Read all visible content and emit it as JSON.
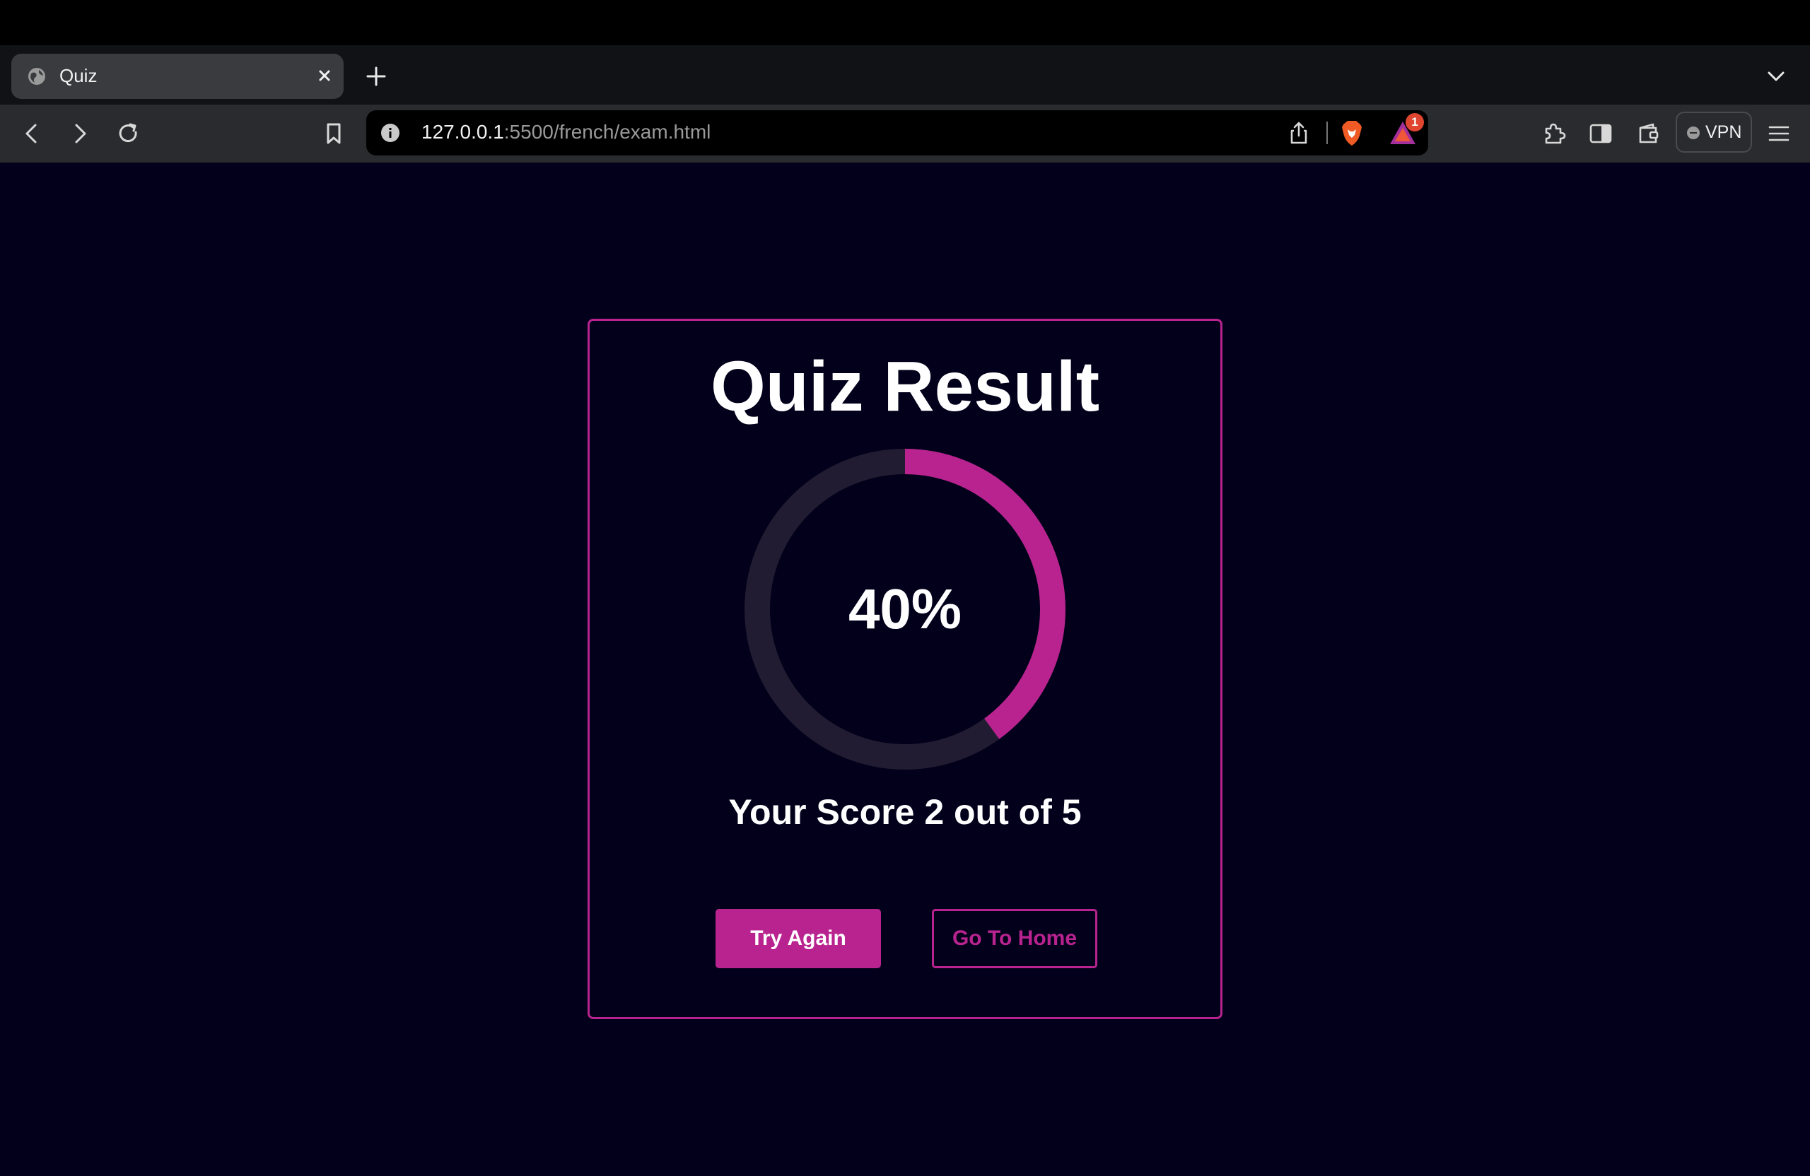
{
  "browser": {
    "tab": {
      "title": "Quiz"
    },
    "address": {
      "host": "127.0.0.1",
      "path": ":5500/french/exam.html"
    },
    "rewards_badge": "1",
    "vpn_label": "VPN"
  },
  "quiz_result": {
    "title": "Quiz Result",
    "percent_label": "40%",
    "progress_fraction": 0.4,
    "score_text": "Your Score 2 out of 5",
    "buttons": {
      "try_again": "Try Again",
      "go_home": "Go To Home"
    }
  },
  "colors": {
    "accent": "#b8238f",
    "page_background": "#02001a",
    "ring_track": "#221c33"
  }
}
